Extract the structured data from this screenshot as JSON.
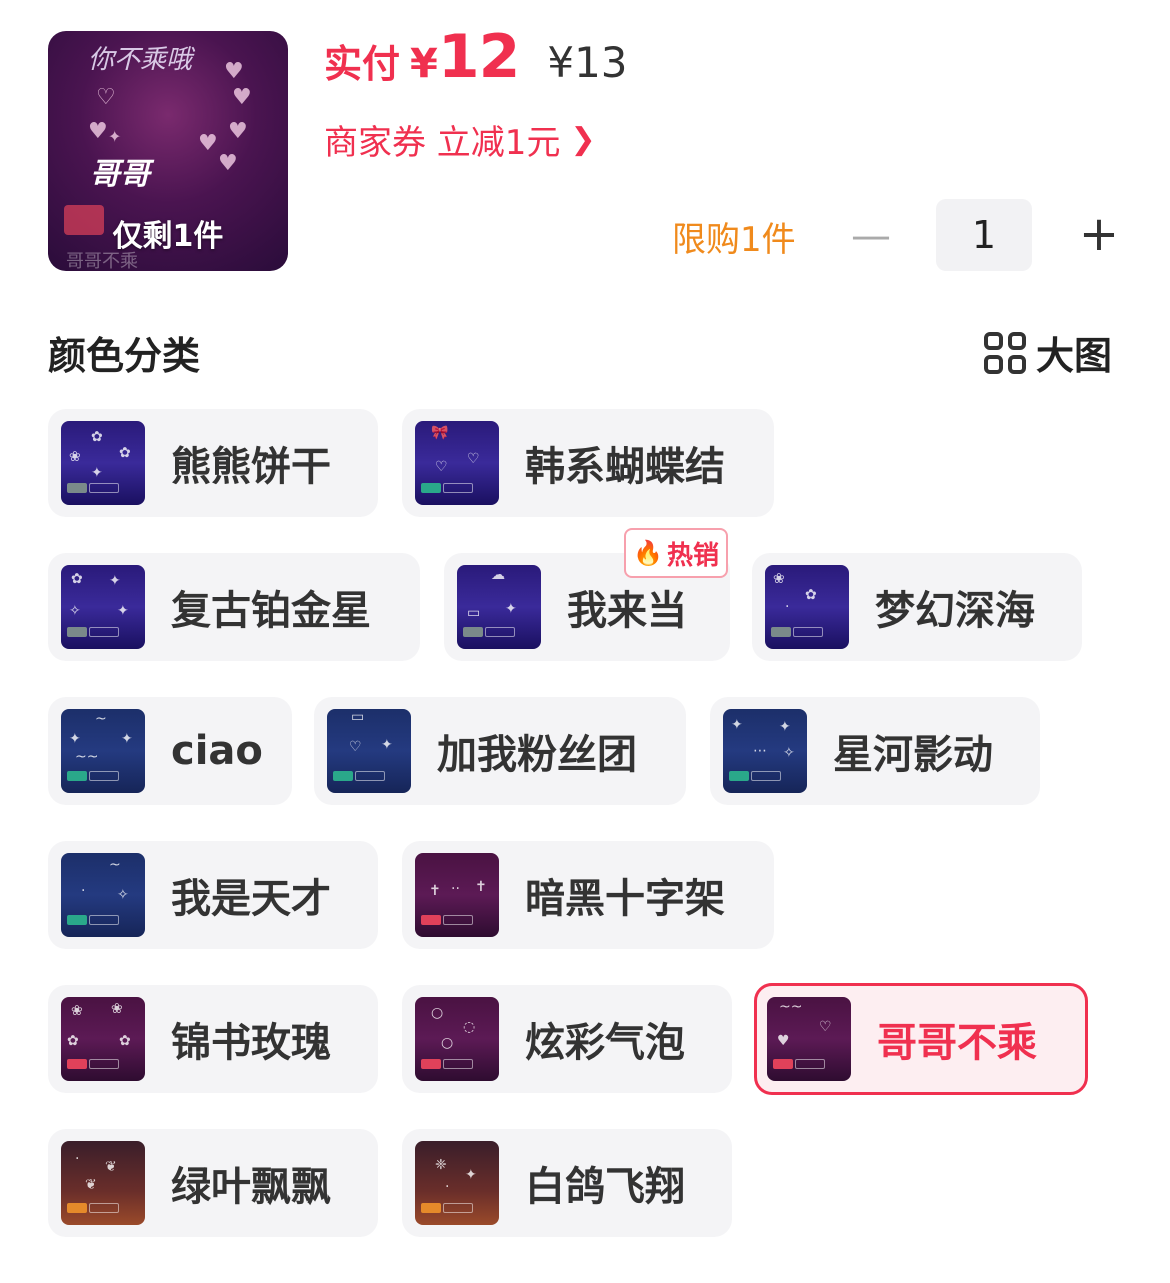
{
  "header": {
    "thumbnail": {
      "stock_text": "仅剩1件",
      "script_text": "你不乘哦",
      "center_text": "哥哥",
      "faint_text": "哥哥不乘"
    },
    "price_label": "实付",
    "currency": "¥",
    "price": "12",
    "original_price": "¥13",
    "coupon_text": "商家券 立减1元",
    "coupon_chevron_icon": "chevron-right-icon",
    "purchase_limit": "限购1件",
    "quantity": "1",
    "minus_symbol": "—",
    "plus_symbol": "+"
  },
  "section": {
    "title": "颜色分类",
    "big_view_label": "大图",
    "big_view_icon": "grid-icon"
  },
  "hot_badge": "热销",
  "colors": {
    "accent": "#f0304f",
    "limit": "#f08a1c",
    "chip_bg": "#f4f4f6"
  },
  "options": [
    {
      "label": "熊熊饼干"
    },
    {
      "label": "韩系蝴蝶结"
    },
    {
      "label": "复古铂金星"
    },
    {
      "label": "我来当"
    },
    {
      "label": "梦幻深海"
    },
    {
      "label": "ciao"
    },
    {
      "label": "加我粉丝团"
    },
    {
      "label": "星河影动"
    },
    {
      "label": "我是天才"
    },
    {
      "label": "暗黑十字架"
    },
    {
      "label": "锦书玫瑰"
    },
    {
      "label": "炫彩气泡"
    },
    {
      "label": "哥哥不乘",
      "selected": true
    },
    {
      "label": "绿叶飘飘"
    },
    {
      "label": "白鸽飞翔"
    }
  ]
}
